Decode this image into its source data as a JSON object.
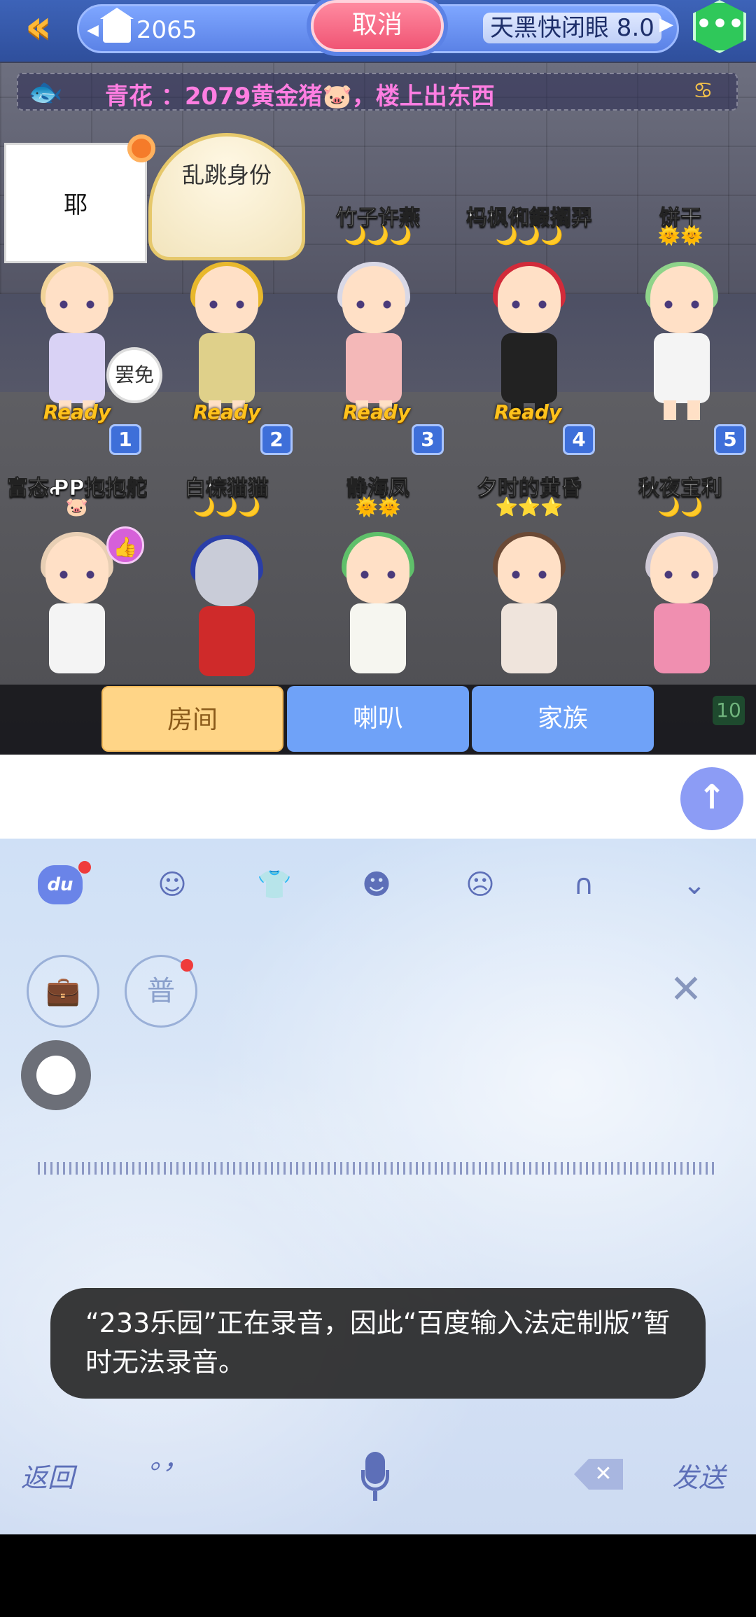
{
  "topbar": {
    "back_icon": "double-chevron-left-icon",
    "room_number": "2065",
    "cancel_label": "取消",
    "mode_label": "天黑快闭眼 8.0",
    "menu_icon": "more-dots-icon"
  },
  "broadcast": {
    "sender": "青花",
    "message": "青花  ：2079黄金猪🐷，楼上出东西"
  },
  "speech_bubble": "耶",
  "umbrella_text": "乱跳身份",
  "fire_badge": "罢免",
  "ready_label": "Ready",
  "players_top": [
    {
      "seat": "1",
      "name": "",
      "level": ""
    },
    {
      "seat": "2",
      "name": "",
      "level": ""
    },
    {
      "seat": "3",
      "name": "竹子许燕",
      "level": "🌙🌙🌙"
    },
    {
      "seat": "4",
      "name": "杩枫俰鍜搁羿",
      "level": "🌙🌙🌙"
    },
    {
      "seat": "5",
      "name": "饼干",
      "level": "🌞🌞"
    }
  ],
  "players_bottom": [
    {
      "name": "富态ꝒP抱抱舵",
      "level": "🐷"
    },
    {
      "name": "白棕猫猫",
      "level": "🌙🌙🌙"
    },
    {
      "name": "静海凤",
      "level": "🌞🌞"
    },
    {
      "name": "夕时的黄昏",
      "level": "⭐⭐⭐"
    },
    {
      "name": "秋夜宝利",
      "level": "🌙🌙"
    }
  ],
  "seat_10": "10",
  "chat_tabs": {
    "room": "房间",
    "horn": "喇叭",
    "clan": "家族"
  },
  "input": {
    "value": "",
    "placeholder": ""
  },
  "keyboard": {
    "du_label": "du",
    "toolbar_icons": [
      "du-logo-icon",
      "emoji-icon",
      "skin-icon",
      "sticker-icon",
      "avatar-icon",
      "handwriting-icon",
      "collapse-keyboard-icon"
    ],
    "putonghua_label": "普",
    "toast": "“233乐园”正在录音，因此“百度输入法定制版”暂时无法录音。",
    "back_label": "返回",
    "punct_label": "。，",
    "send_label": "发送"
  },
  "colors": {
    "accent_blue": "#6fa2f8",
    "cancel_pink": "#f05574",
    "ready_gold": "#ffc21c",
    "broadcast_pink": "#ff7ee2"
  }
}
